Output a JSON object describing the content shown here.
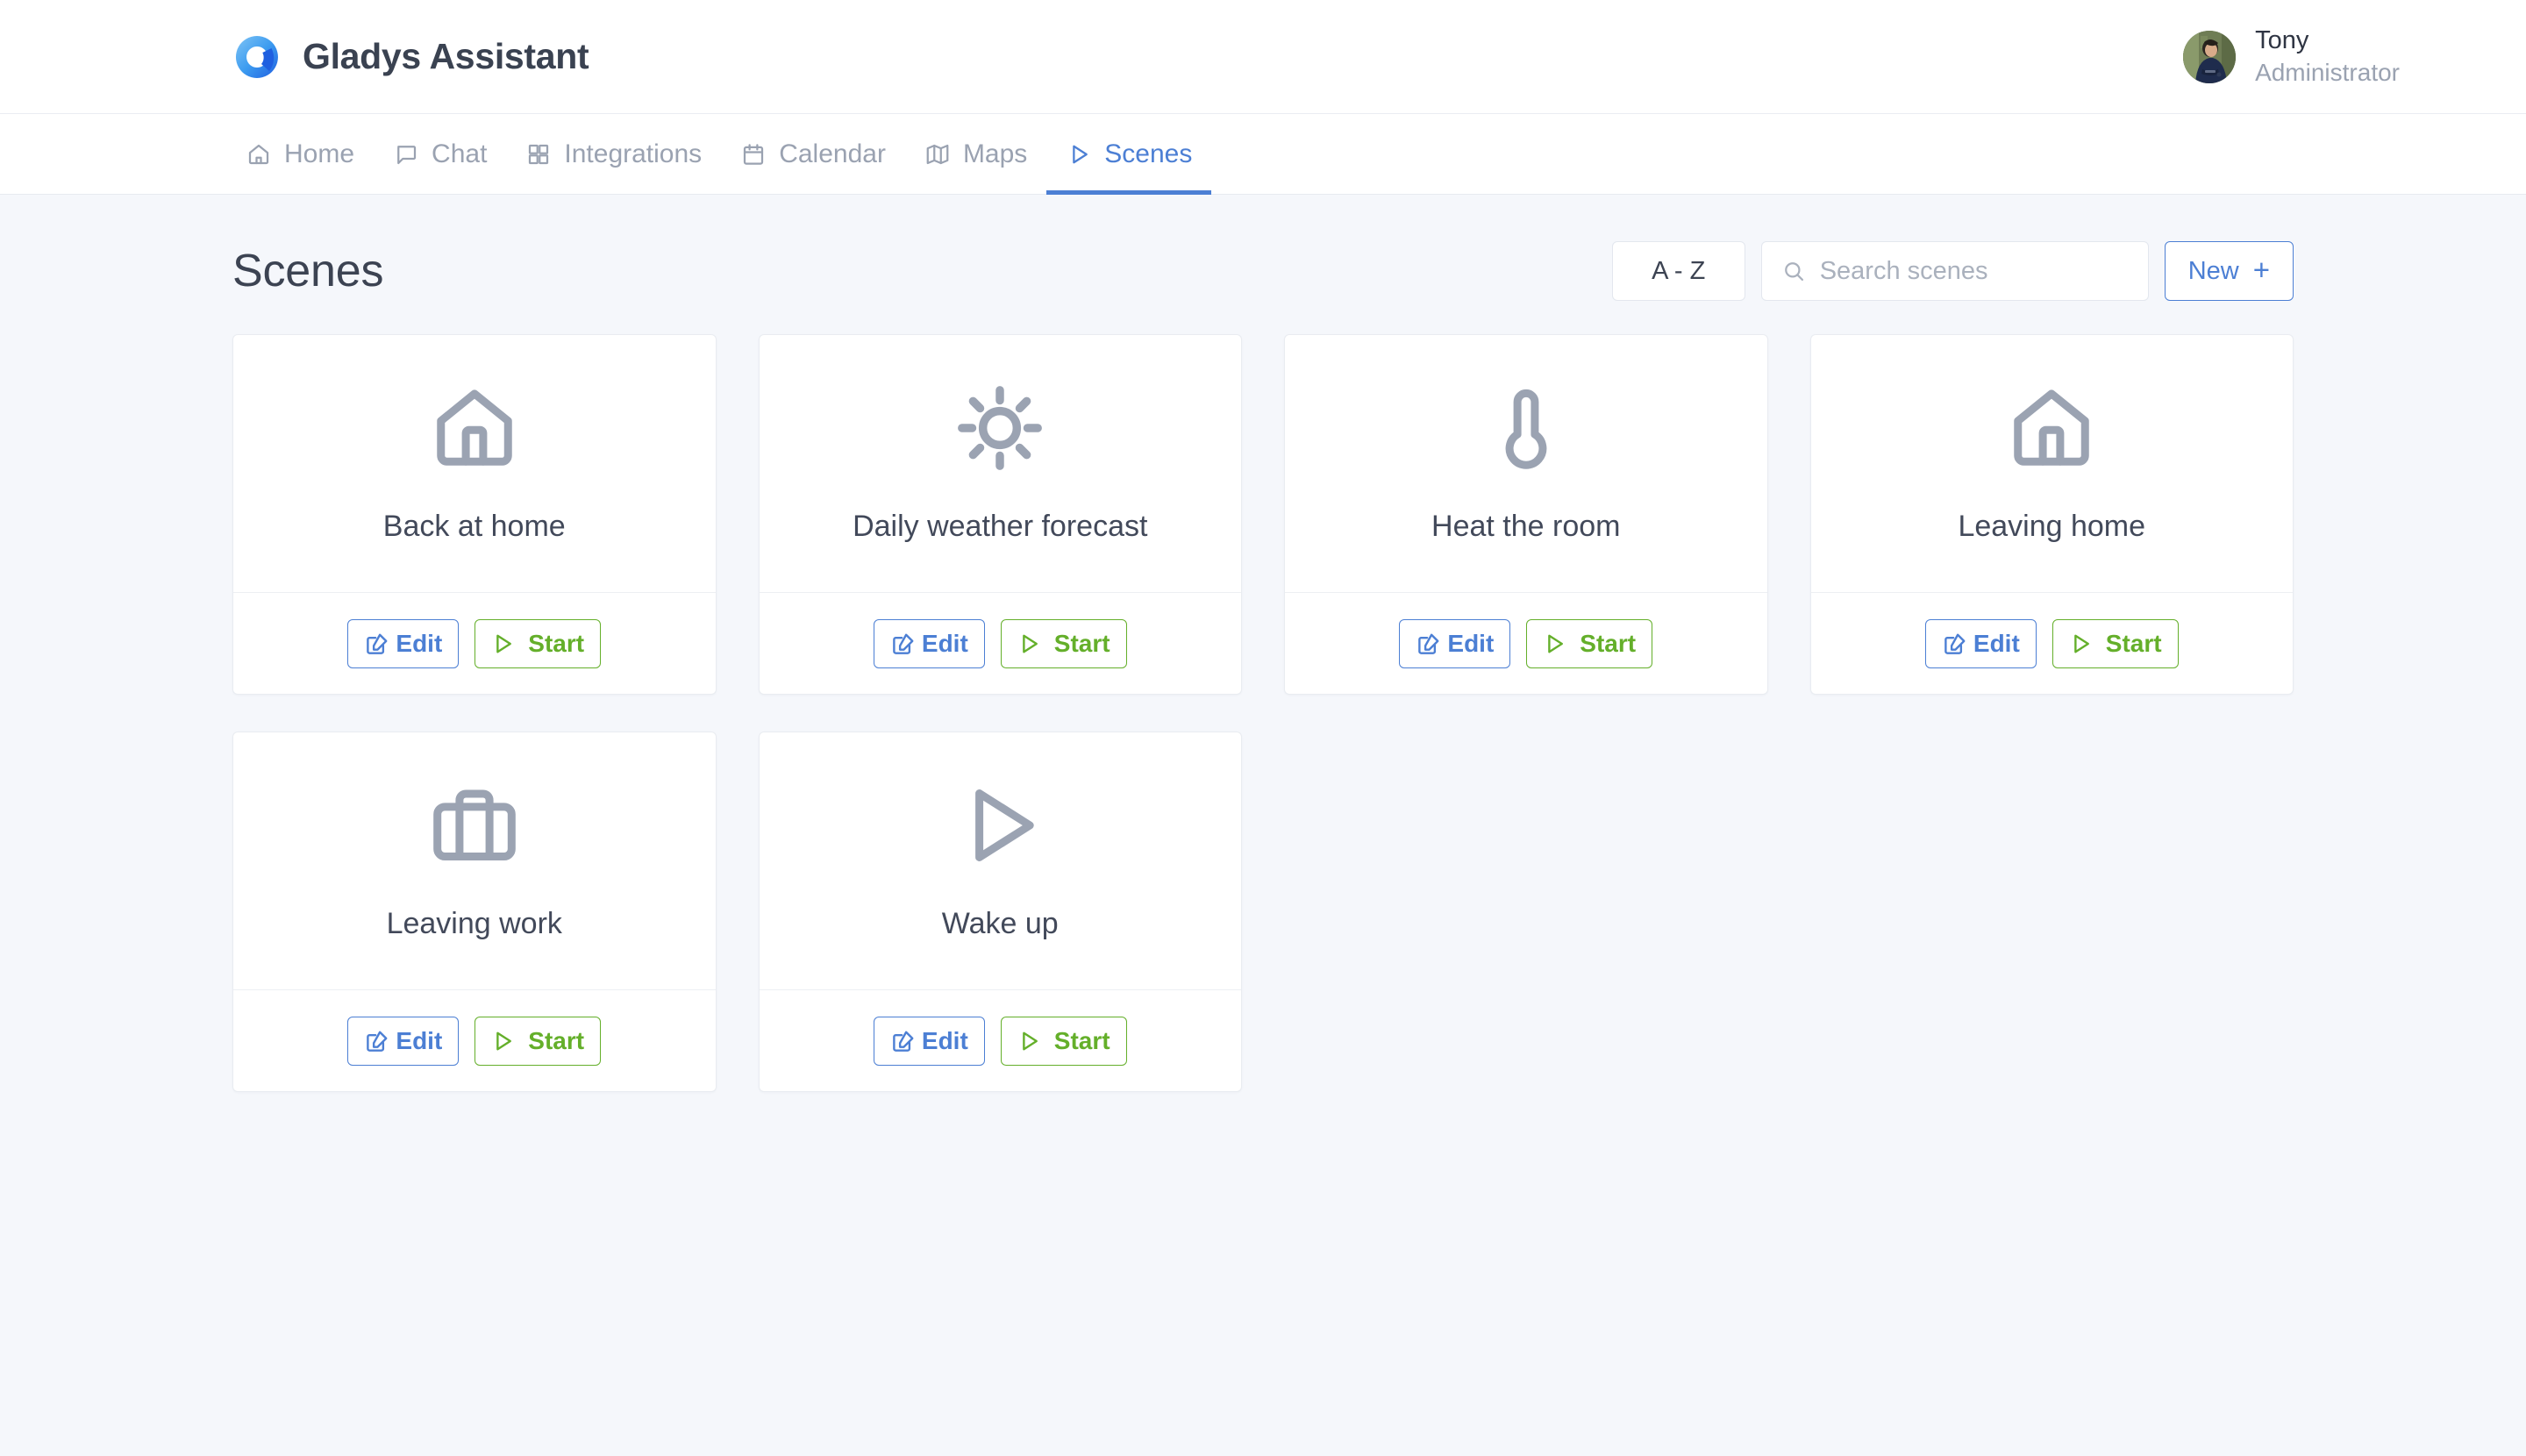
{
  "header": {
    "brand": "Gladys Assistant",
    "logo_icon": "gladys-ring-logo",
    "user": {
      "name": "Tony",
      "role": "Administrator",
      "avatar_icon": "user-avatar-photo"
    }
  },
  "nav": {
    "items": [
      {
        "label": "Home",
        "icon": "home-icon",
        "active": false
      },
      {
        "label": "Chat",
        "icon": "chat-bubble-icon",
        "active": false
      },
      {
        "label": "Integrations",
        "icon": "grid-icon",
        "active": false
      },
      {
        "label": "Calendar",
        "icon": "calendar-icon",
        "active": false
      },
      {
        "label": "Maps",
        "icon": "map-icon",
        "active": false
      },
      {
        "label": "Scenes",
        "icon": "play-icon",
        "active": true
      }
    ]
  },
  "main": {
    "title": "Scenes",
    "toolbar": {
      "sort_label": "A - Z",
      "search_placeholder": "Search scenes",
      "search_value": "",
      "search_icon": "search-icon",
      "new_label": "New",
      "new_plus": "+"
    },
    "buttons": {
      "edit_label": "Edit",
      "edit_icon": "edit-square-icon",
      "start_label": "Start",
      "start_icon": "play-triangle-icon"
    },
    "scenes": [
      {
        "name": "Back at home",
        "icon": "house-icon"
      },
      {
        "name": "Daily weather forecast",
        "icon": "sun-icon"
      },
      {
        "name": "Heat the room",
        "icon": "thermometer-icon"
      },
      {
        "name": "Leaving home",
        "icon": "house-icon"
      },
      {
        "name": "Leaving work",
        "icon": "briefcase-icon"
      },
      {
        "name": "Wake up",
        "icon": "play-triangle-icon"
      }
    ]
  },
  "colors": {
    "accent_blue": "#4c7fd4",
    "accent_green": "#64af2a",
    "page_bg": "#f5f7fb",
    "card_bg": "#ffffff",
    "icon_grey": "#9ba3b2",
    "text_dark": "#3c4352",
    "text_muted": "#9aa2b1"
  }
}
